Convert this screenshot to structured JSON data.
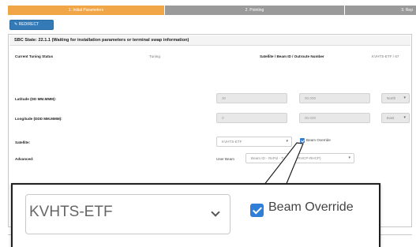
{
  "tabs": [
    {
      "label": "1. Initial Parameters"
    },
    {
      "label": "2. Pointing"
    },
    {
      "label": "3. Rep"
    }
  ],
  "toolbar": {
    "redirect_label": "REDIRECT"
  },
  "panel": {
    "sbc_state": "SBC State: 22.1.1 (Waiting for installation parameters or terminal swap information)",
    "status": {
      "current_tuning_label": "Current Tuning Status",
      "current_tuning_value": "Tuning",
      "satellite_beam_label": "Satellite / Beam ID / Outroute Number",
      "satellite_beam_value": "KVHTS-ETF / 67"
    },
    "latitude": {
      "label": "Latitude (DD MM.MMM):",
      "deg": "30",
      "min": "00.000",
      "dir": "North"
    },
    "longitude": {
      "label": "Longitude (DDD MM.MMM):",
      "deg": "0",
      "min": "00.000",
      "dir": "East"
    },
    "satellite": {
      "label": "Satellite:",
      "value": "KVHTS-ETF",
      "override_label": "Beam Override"
    },
    "advanced": {
      "label": "Advanced:",
      "user_beam_label": "User Beam",
      "user_beam_value": "Beam ID - RxPol - TxPol (66-RHCP-RHCP)"
    }
  },
  "zoom": {
    "satellite_value": "KVHTS-ETF",
    "override_label": "Beam Override"
  },
  "colors": {
    "active_tab": "#f0a646",
    "inactive_tab": "#9a9a9a",
    "primary": "#337ab7",
    "checkbox": "#2f7fd8"
  }
}
